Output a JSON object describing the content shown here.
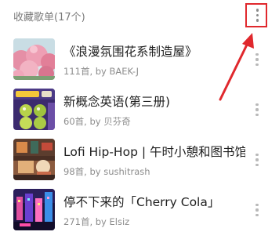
{
  "header": {
    "title": "收藏歌单(17个)"
  },
  "playlists": [
    {
      "title": "《浪漫氛围花系制造屋》",
      "subtitle": "111首, by BAEK-J",
      "cover_icon": "pink-flowers-cover"
    },
    {
      "title": "新概念英语(第三册)",
      "subtitle": "60首, by 贝芬奇",
      "cover_icon": "new-concept-english-cover"
    },
    {
      "title": "Lofi Hip-Hop | 午时小憩和图书馆",
      "subtitle": "98首, by sushitrash",
      "cover_icon": "lofi-room-cover"
    },
    {
      "title": "停不下来的「Cherry Cola」",
      "subtitle": "271首, by Elsiz",
      "cover_icon": "neon-city-cover"
    }
  ],
  "colors": {
    "annotation_red": "#e0282d",
    "title_text": "#202020",
    "secondary_text": "#8d8d8d"
  }
}
